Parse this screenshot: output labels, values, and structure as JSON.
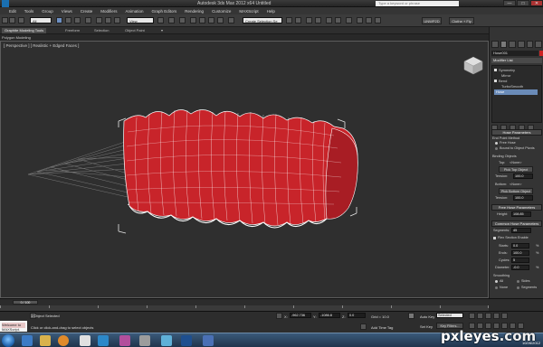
{
  "window": {
    "title": "Autodesk 3ds Max 2012 x64   Untitled",
    "search_placeholder": "Type a keyword or phrase",
    "min_label": "—",
    "max_label": "□",
    "close_label": "✕"
  },
  "menu": [
    "Edit",
    "Tools",
    "Group",
    "Views",
    "Create",
    "Modifiers",
    "Animation",
    "Graph Editors",
    "Rendering",
    "Customize",
    "MAXScript",
    "Help"
  ],
  "toolbar": {
    "selection_filter": "All",
    "reference_coord": "View",
    "named_selection": "Create Selection Se",
    "unwrap_label": "UNWP2D",
    "cloth_label": "Clothe + Fly"
  },
  "ribbon": {
    "tabs": [
      "Graphite Modeling Tools",
      "Freeform",
      "Selection",
      "Object Paint"
    ],
    "active_tab": "Graphite Modeling Tools",
    "subpanel": "Polygon Modeling"
  },
  "viewport": {
    "label": "[ Perspective ] [ Realistic + Edged Faces ]",
    "object_color": "#c8242a",
    "wire_color": "#ffffff",
    "grid_color": "#8a8a8a"
  },
  "command_panel": {
    "object_name": "Hose001",
    "modifier_list_label": "Modifier List",
    "stack": [
      "Symmetry",
      "Mirror",
      "Bend",
      "TurboSmooth",
      "Hose"
    ],
    "selected_stack": "Hose",
    "hose_parameters_title": "Hose Parameters",
    "end_point_method_label": "End Point Method",
    "free_hose_label": "Free Hose",
    "bound_label": "Bound to Object Pivots",
    "binding_objects_label": "Binding Objects",
    "top_label": "Top:",
    "top_value": "<None>",
    "pick_top_label": "Pick Top Object",
    "tension_label": "Tension:",
    "tension_value": "100.0",
    "bottom_label": "Bottom:",
    "bottom_value": "<None>",
    "pick_bottom_label": "Pick Bottom Object",
    "tension2_value": "100.0",
    "free_hose_params_title": "Free Hose Parameters",
    "height_label": "Height:",
    "height_value": "108.85",
    "common_hose_params_title": "Common Hose Parameters",
    "segments_label": "Segments:",
    "segments_value": "45",
    "flex_section_label": "Flex Section Enable",
    "starts_label": "Starts:",
    "starts_value": "0.0",
    "ends_label": "Ends:",
    "ends_value": "100.0",
    "cycles_label": "Cycles:",
    "cycles_value": "5",
    "diameter_label": "Diameter:",
    "diameter_value": "-0.0",
    "smoothing_label": "Smoothing",
    "smooth_all": "All",
    "smooth_sides": "Sides",
    "smooth_none": "None",
    "smooth_segments": "Segments",
    "percent": "%"
  },
  "timeline": {
    "frame_label": "0 / 100",
    "ticks": [
      "0",
      "10",
      "20",
      "30",
      "40",
      "50",
      "60",
      "70",
      "80",
      "90",
      "100"
    ]
  },
  "status": {
    "objects_selected": "1 Object Selected",
    "prompt": "Click or click-and-drag to select objects",
    "x_label": "X:",
    "x_value": "-962.736",
    "y_label": "Y:",
    "y_value": "-1086.8",
    "z_label": "Z:",
    "z_value": "0.0",
    "grid_label": "Grid = 10.0",
    "auto_key_label": "Auto Key",
    "set_key_label": "Set Key",
    "selected_label": "Selected",
    "key_filters_label": "Key Filters...",
    "add_time_tag": "Add Time Tag",
    "maxscript_text": "Welcome to MAXScript."
  },
  "taskbar": {
    "clock": "10/26/2012"
  },
  "watermark": {
    "brand": "pxleyes",
    "tld": ".com"
  }
}
